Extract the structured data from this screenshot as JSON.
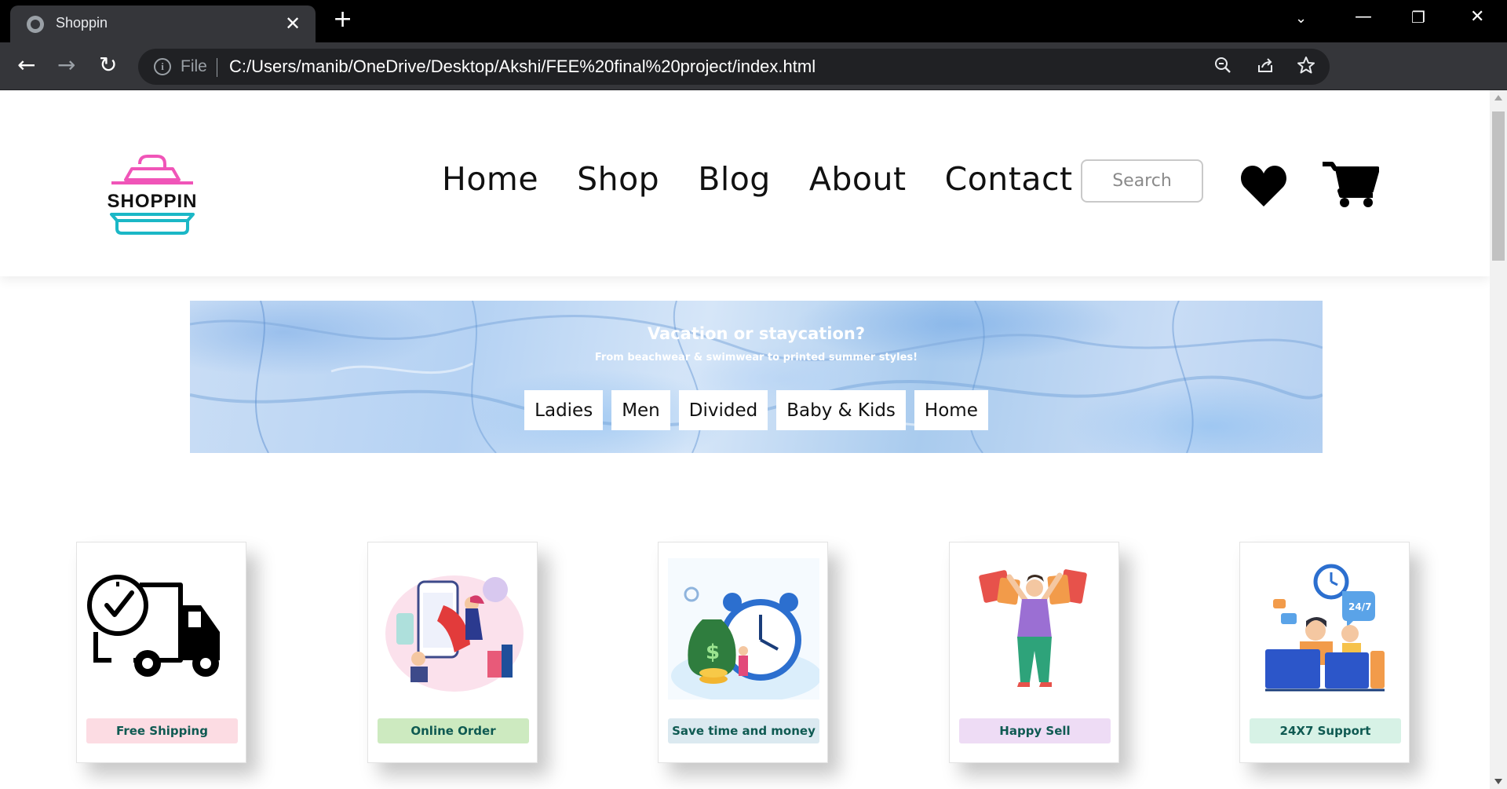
{
  "browser": {
    "tab_title": "Shoppin",
    "url_scheme": "File",
    "url": "C:/Users/manib/OneDrive/Desktop/Akshi/FEE%20final%20project/index.html"
  },
  "header": {
    "logo_text": "SHOPPIN",
    "nav": [
      "Home",
      "Shop",
      "Blog",
      "About",
      "Contact"
    ],
    "search_placeholder": "Search"
  },
  "banner": {
    "title": "Vacation or staycation?",
    "subtitle": "From beachwear & swimwear to printed summer styles!",
    "buttons": [
      "Ladies",
      "Men",
      "Divided",
      "Baby & Kids",
      "Home"
    ]
  },
  "features": [
    {
      "label": "Free Shipping",
      "color": "#fcdce3"
    },
    {
      "label": "Online Order",
      "color": "#cdeac0"
    },
    {
      "label": "Save time and money",
      "color": "#dbe9f0"
    },
    {
      "label": "Happy Sell",
      "color": "#eedcf5"
    },
    {
      "label": "24X7 Support",
      "color": "#d7f2e6"
    }
  ],
  "colors": {
    "logo_pink": "#f055b8",
    "logo_teal": "#1bb7c6",
    "label_text": "#0f5a52"
  }
}
